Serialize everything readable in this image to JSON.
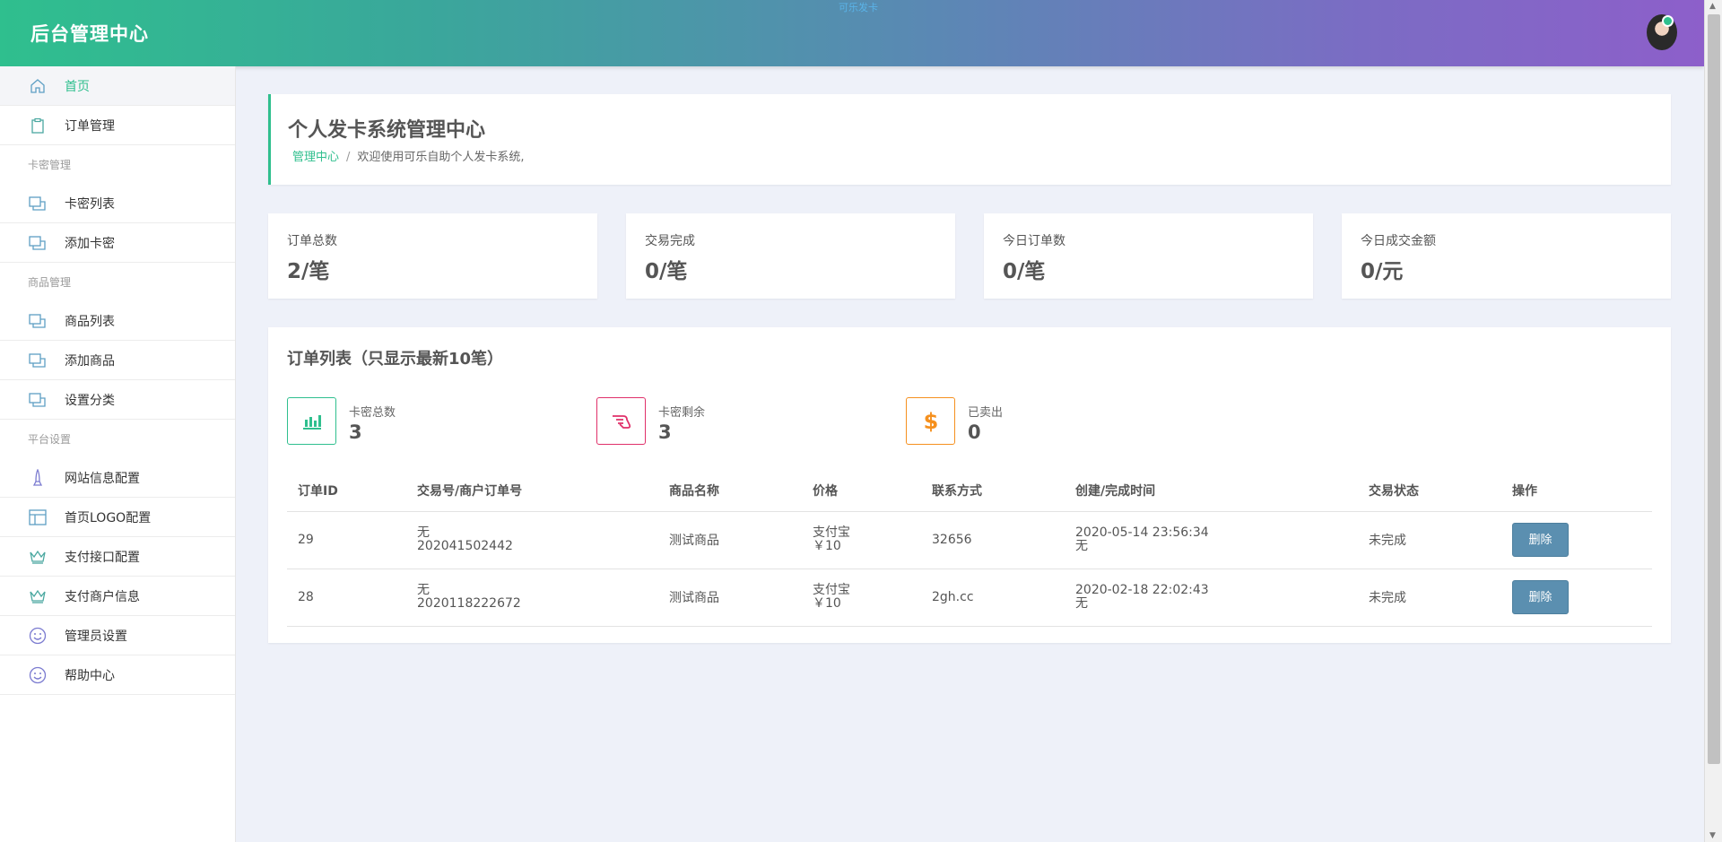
{
  "header": {
    "brand": "后台管理中心",
    "top_center_text": "可乐发卡"
  },
  "sidebar": {
    "items": [
      {
        "type": "item",
        "label": "首页",
        "icon": "home-icon",
        "active": true
      },
      {
        "type": "item",
        "label": "订单管理",
        "icon": "clipboard-icon"
      },
      {
        "type": "group",
        "label": "卡密管理"
      },
      {
        "type": "item",
        "label": "卡密列表",
        "icon": "cards-icon"
      },
      {
        "type": "item",
        "label": "添加卡密",
        "icon": "cards-icon"
      },
      {
        "type": "group",
        "label": "商品管理"
      },
      {
        "type": "item",
        "label": "商品列表",
        "icon": "cards-icon"
      },
      {
        "type": "item",
        "label": "添加商品",
        "icon": "cards-icon"
      },
      {
        "type": "item",
        "label": "设置分类",
        "icon": "cards-icon"
      },
      {
        "type": "group",
        "label": "平台设置"
      },
      {
        "type": "item",
        "label": "网站信息配置",
        "icon": "rocket-icon"
      },
      {
        "type": "item",
        "label": "首页LOGO配置",
        "icon": "layout-icon"
      },
      {
        "type": "item",
        "label": "支付接口配置",
        "icon": "crown-icon"
      },
      {
        "type": "item",
        "label": "支付商户信息",
        "icon": "crown-icon"
      },
      {
        "type": "item",
        "label": "管理员设置",
        "icon": "smile-icon"
      },
      {
        "type": "item",
        "label": "帮助中心",
        "icon": "smile-icon"
      }
    ]
  },
  "title_card": {
    "title": "个人发卡系统管理中心",
    "breadcrumb_link": "管理中心",
    "breadcrumb_sep": "/",
    "breadcrumb_text": "欢迎使用可乐自助个人发卡系统,"
  },
  "stats": [
    {
      "label": "订单总数",
      "value": "2/笔"
    },
    {
      "label": "交易完成",
      "value": "0/笔"
    },
    {
      "label": "今日订单数",
      "value": "0/笔"
    },
    {
      "label": "今日成交金额",
      "value": "0/元"
    }
  ],
  "orders": {
    "title": "订单列表（只显示最新10笔）",
    "mini_stats": [
      {
        "label": "卡密总数",
        "value": "3",
        "icon": "bar-chart-icon",
        "color": "#2fbf8e"
      },
      {
        "label": "卡密剩余",
        "value": "3",
        "icon": "hand-icon",
        "color": "#e0306a"
      },
      {
        "label": "已卖出",
        "value": "0",
        "icon": "dollar-icon",
        "color": "#f5901e"
      }
    ],
    "columns": [
      "订单ID",
      "交易号/商户订单号",
      "商品名称",
      "价格",
      "联系方式",
      "创建/完成时间",
      "交易状态",
      "操作"
    ],
    "rows": [
      {
        "id": "29",
        "trade_no": "无",
        "merchant_no": "202041502442",
        "product": "测试商品",
        "pay_method": "支付宝",
        "price": "￥10",
        "contact": "32656",
        "created": "2020-05-14 23:56:34",
        "finished": "无",
        "status": "未完成",
        "action": "删除"
      },
      {
        "id": "28",
        "trade_no": "无",
        "merchant_no": "2020118222672",
        "product": "测试商品",
        "pay_method": "支付宝",
        "price": "￥10",
        "contact": "2gh.cc",
        "created": "2020-02-18 22:02:43",
        "finished": "无",
        "status": "未完成",
        "action": "删除"
      }
    ]
  },
  "colors": {
    "accent": "#2fbf8e",
    "status_red": "#e02020",
    "button": "#5b8fb0"
  }
}
